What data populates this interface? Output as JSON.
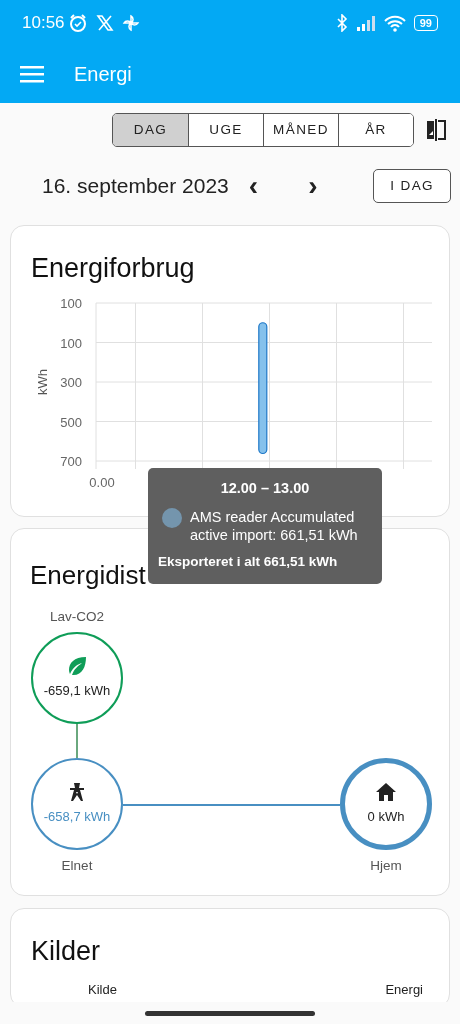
{
  "status_bar": {
    "time": "10:56",
    "battery": "99"
  },
  "app_bar": {
    "title": "Energi"
  },
  "period_tabs": [
    {
      "label": "DAG",
      "selected": true
    },
    {
      "label": "UGE",
      "selected": false
    },
    {
      "label": "MÅNED",
      "selected": false
    },
    {
      "label": "ÅR",
      "selected": false
    }
  ],
  "date_bar": {
    "date": "16. september 2023",
    "prev": "‹",
    "next": "›",
    "today_button": "I DAG"
  },
  "consumption_card": {
    "title": "Energiforbrug",
    "chart_data": {
      "type": "bar",
      "ylabel": "kWh",
      "grid": true,
      "annotations": [
        {
          "text": "0.00"
        }
      ],
      "series": [
        {
          "name": "AMS reader Accumulated active import",
          "color": "#85c1ec",
          "values": [
            662
          ]
        }
      ],
      "ylim": [
        700,
        -100
      ],
      "yticks": [
        {
          "value": -100,
          "label": "100"
        },
        {
          "value": 100,
          "label": "100"
        },
        {
          "value": 300,
          "label": "300"
        },
        {
          "value": 500,
          "label": "500"
        },
        {
          "value": 700,
          "label": "700"
        }
      ]
    },
    "tooltip": {
      "heading": "12.00 – 13.00",
      "reading": ": 661,51 kWh",
      "total": "Eksporteret i alt 661,51 kWh"
    }
  },
  "distribution_card": {
    "title": "Energidist",
    "nodes": [
      {
        "kind": "low_carbon",
        "label": "Lav-CO2",
        "value": "-659,1 kWh"
      },
      {
        "kind": "grid",
        "label": "Elnet",
        "value": "-658,7 kWh"
      },
      {
        "kind": "home",
        "label": "Hjem",
        "value": "0 kWh"
      }
    ]
  },
  "sources_card": {
    "title": "Kilder",
    "columns": [
      "Kilde",
      "Energi"
    ]
  }
}
